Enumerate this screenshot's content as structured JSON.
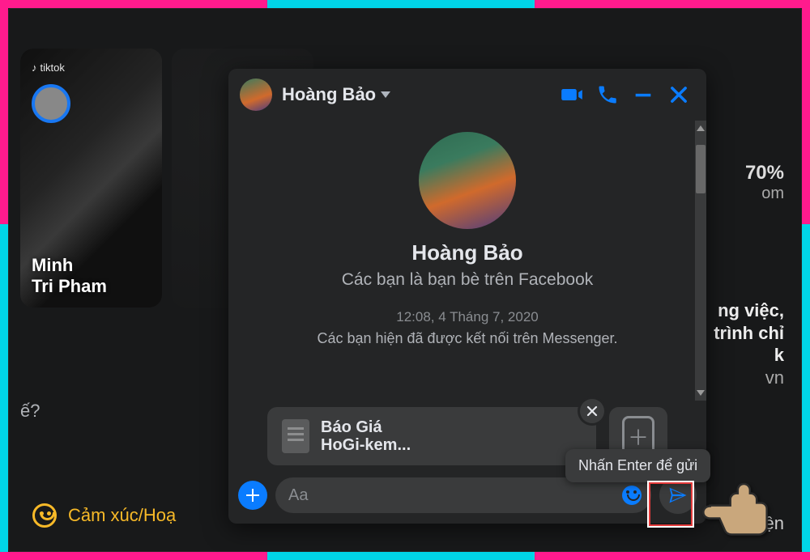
{
  "story": {
    "brand_label": "tiktok",
    "name": "Minh Tri Pham"
  },
  "chat": {
    "header": {
      "name": "Hoàng Bảo"
    },
    "profile": {
      "name": "Hoàng Bảo",
      "friend_status": "Các bạn là bạn bè trên Facebook"
    },
    "timestamp": "12:08, 4 Tháng 7, 2020",
    "connected_msg": "Các bạn hiện đã được kết nối trên Messenger.",
    "attachment": {
      "line1": "Báo Giá",
      "line2": "HoGi-kem..."
    },
    "input_placeholder": "Aa",
    "send_tooltip": "Nhấn Enter để gửi"
  },
  "background": {
    "prompt_suffix": "ế?",
    "emoji_label": "Cảm xúc/Hoạ",
    "stat_value": "70%",
    "stat_sub": "om",
    "headline_l1": "ng việc,",
    "headline_l2": "trình chỉ",
    "headline_l3": "k",
    "headline_sub": "vn",
    "footer": "e Thiện"
  }
}
